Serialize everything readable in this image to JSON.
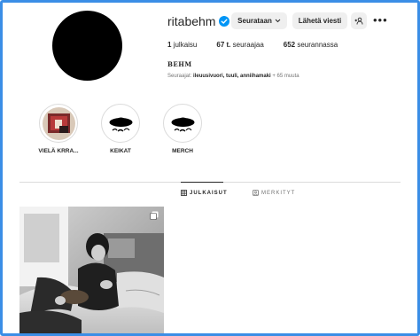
{
  "profile": {
    "username": "ritabehm",
    "verified": true,
    "follow_button": "Seurataan",
    "message_button": "Lähetä viesti"
  },
  "stats": {
    "posts_count": "1",
    "posts_label": "julkaisu",
    "followers_count": "67 t.",
    "followers_label": "seuraajaa",
    "following_count": "652",
    "following_label": "seurannassa"
  },
  "bio": {
    "name": "BEHM",
    "followed_by_prefix": "Seuraajat:",
    "followed_by_names": "ileuusivuori, tuuli, anniihamaki",
    "followed_by_more": "+ 65 muuta"
  },
  "highlights": [
    {
      "label": "VIELÄ KRRA..."
    },
    {
      "label": "KEIKAT"
    },
    {
      "label": "MERCH"
    }
  ],
  "tabs": {
    "posts": "JULKAISUT",
    "tagged": "MERKITYT"
  },
  "icons": {
    "verified": "verified-badge-icon",
    "chevron": "chevron-down-icon",
    "add_user": "add-user-icon",
    "more": "more-options-icon",
    "grid": "grid-icon",
    "tagged": "tagged-icon",
    "multi": "multiple-photos-icon"
  },
  "colors": {
    "verified": "#0095f6",
    "button_bg": "#efefef",
    "frame": "#3b8ee6"
  }
}
